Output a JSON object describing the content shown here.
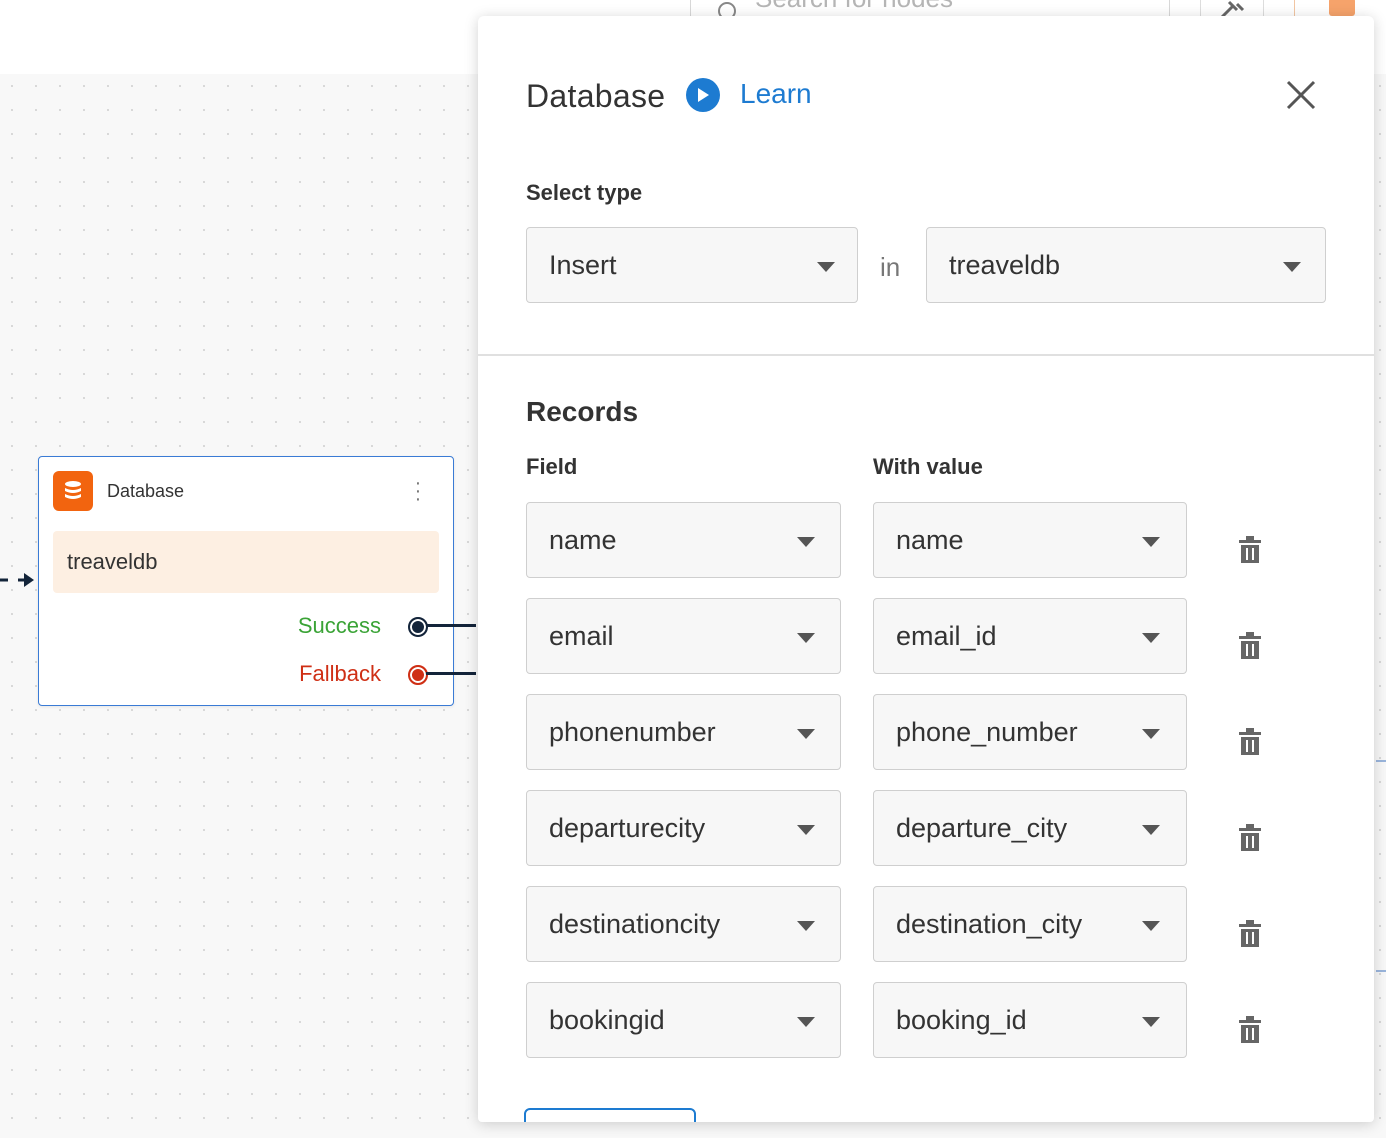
{
  "topbar": {
    "search_placeholder": "Search for nodes"
  },
  "node": {
    "title": "Database",
    "body": "treaveldb",
    "success_label": "Success",
    "fallback_label": "Fallback"
  },
  "panel": {
    "title": "Database",
    "learn_label": "Learn",
    "select_type_label": "Select type",
    "type_value": "Insert",
    "in_word": "in",
    "db_value": "treaveldb",
    "records_title": "Records",
    "col_field": "Field",
    "col_value": "With value",
    "records": [
      {
        "field": "name",
        "value": "name"
      },
      {
        "field": "email",
        "value": "email_id"
      },
      {
        "field": "phonenumber",
        "value": "phone_number"
      },
      {
        "field": "departurecity",
        "value": "departure_city"
      },
      {
        "field": "destinationcity",
        "value": "destination_city"
      },
      {
        "field": "bookingid",
        "value": "booking_id"
      }
    ]
  },
  "colors": {
    "accent": "#1d7bd1",
    "node_icon": "#f2640f",
    "success": "#3aa336",
    "fallback": "#cf2f15"
  },
  "icons": [
    "search-icon",
    "tools-icon",
    "database-icon",
    "more-vertical-icon",
    "play-icon",
    "close-icon",
    "trash-icon",
    "chevron-down-icon"
  ]
}
